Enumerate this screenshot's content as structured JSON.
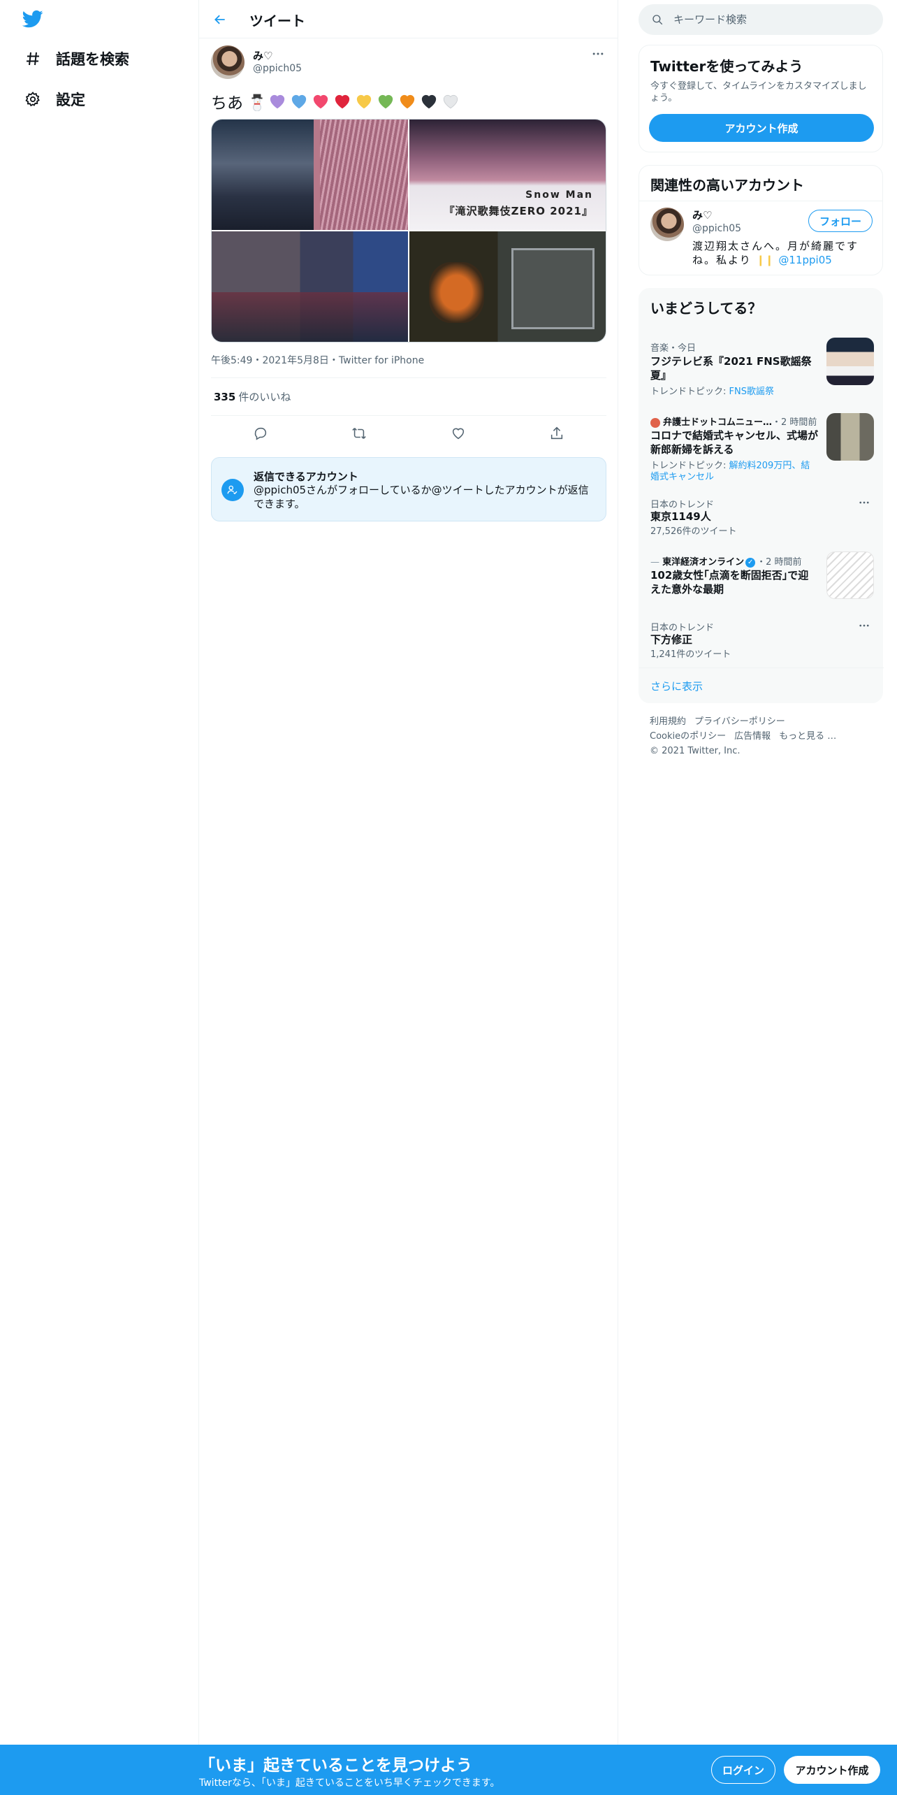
{
  "nav": {
    "explore_label": "話題を検索",
    "settings_label": "設定"
  },
  "header": {
    "title": "ツイート"
  },
  "tweet": {
    "author_name": "み♡",
    "author_handle": "@ppich05",
    "text": "ちあ",
    "emoji_hearts": [
      "#a98bdc",
      "#5ea8e6",
      "#f2486e",
      "#e0243c",
      "#f7c948",
      "#75b856",
      "#f08c1a",
      "#2b313a",
      "#e6e8ea"
    ],
    "image_caption_line1": "Snow Man",
    "image_caption_line2": "『滝沢歌舞伎ZERO 2021』",
    "time": "午後5:49",
    "date": "2021年5月8日",
    "source": "Twitter for iPhone",
    "likes_count": "335",
    "likes_label": "件のいいね"
  },
  "reply_settings": {
    "title": "返信できるアカウント",
    "desc": "@ppich05さんがフォローしているか@ツイートしたアカウントが返信できます。"
  },
  "search": {
    "placeholder": "キーワード検索"
  },
  "signup": {
    "title": "Twitterを使ってみよう",
    "desc": "今すぐ登録して、タイムラインをカスタマイズしましょう。",
    "button": "アカウント作成"
  },
  "related": {
    "title": "関連性の高いアカウント",
    "name": "み♡",
    "handle": "@ppich05",
    "follow": "フォロー",
    "bio": "渡辺翔太さんへ。月が綺麗ですね。私より",
    "bio_mention": "@11ppi05"
  },
  "trends": {
    "title": "いまどうしてる？",
    "items": [
      {
        "ctx": "音楽・今日",
        "title": "フジテレビ系『2021 FNS歌謡祭 夏』",
        "sub_prefix": "トレンドトピック: ",
        "sub_link": "FNS歌謡祭"
      },
      {
        "ctx_source": "弁護士ドットコムニュー…",
        "ctx_time": "・2 時間前",
        "title": "コロナで結婚式キャンセル、式場が新郎新婦を訴える",
        "sub_prefix": "トレンドトピック: ",
        "sub_link": "解約料209万円、結婚式キャンセル"
      },
      {
        "ctx": "日本のトレンド",
        "title": "東京1149人",
        "sub": "27,526件のツイート"
      },
      {
        "ctx_source": "東洋経済オンライン",
        "ctx_time": "・2 時間前",
        "title": "102歳女性｢点滴を断固拒否｣で迎えた意外な最期"
      },
      {
        "ctx": "日本のトレンド",
        "title": "下方修正",
        "sub": "1,241件のツイート"
      }
    ],
    "show_more": "さらに表示"
  },
  "footer": {
    "terms": "利用規約",
    "privacy": "プライバシーポリシー",
    "cookie": "Cookieのポリシー",
    "ads": "広告情報",
    "more": "もっと見る …",
    "copyright": "© 2021 Twitter, Inc."
  },
  "banner": {
    "title": "「いま」起きていることを見つけよう",
    "sub": "Twitterなら、「いま」起きていることをいち早くチェックできます。",
    "login": "ログイン",
    "signup": "アカウント作成"
  },
  "colors": {
    "accent": "#1d9bf0",
    "text": "#0f1419",
    "secondary": "#536471"
  }
}
